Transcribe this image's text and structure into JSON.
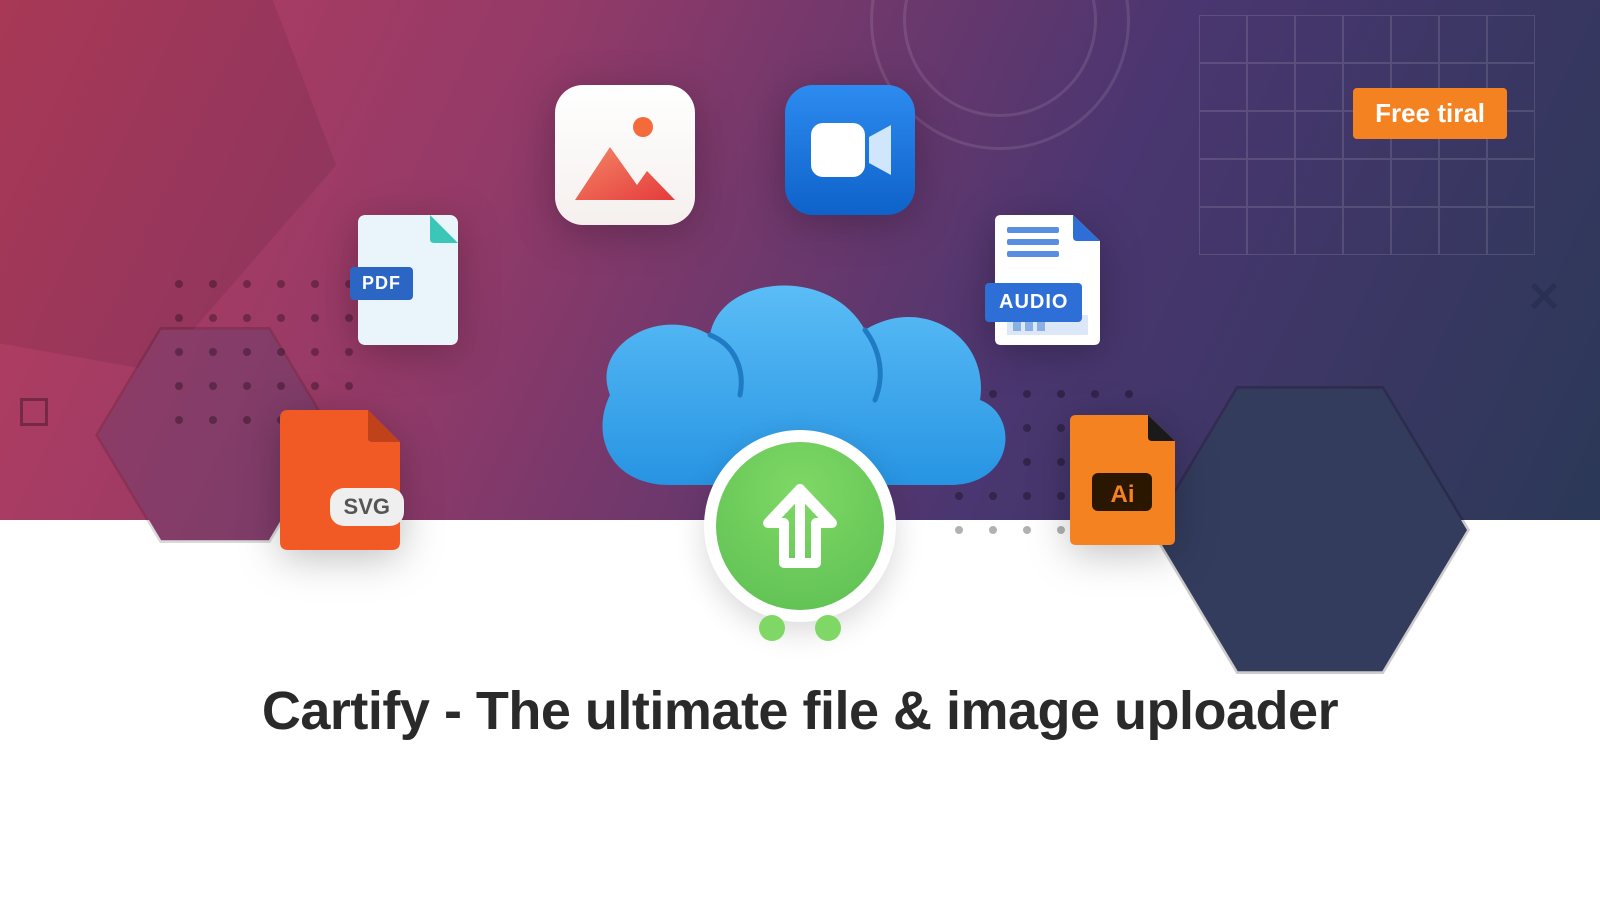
{
  "cta": {
    "label": "Free tiral"
  },
  "headline": "Cartify - The ultimate file & image uploader",
  "filetypes": {
    "pdf": "PDF",
    "audio": "AUDIO",
    "svg": "SVG",
    "ai": "Ai"
  },
  "colors": {
    "accent_orange": "#f58220",
    "upload_green": "#6fc962",
    "cloud_blue": "#3ca9f5"
  }
}
